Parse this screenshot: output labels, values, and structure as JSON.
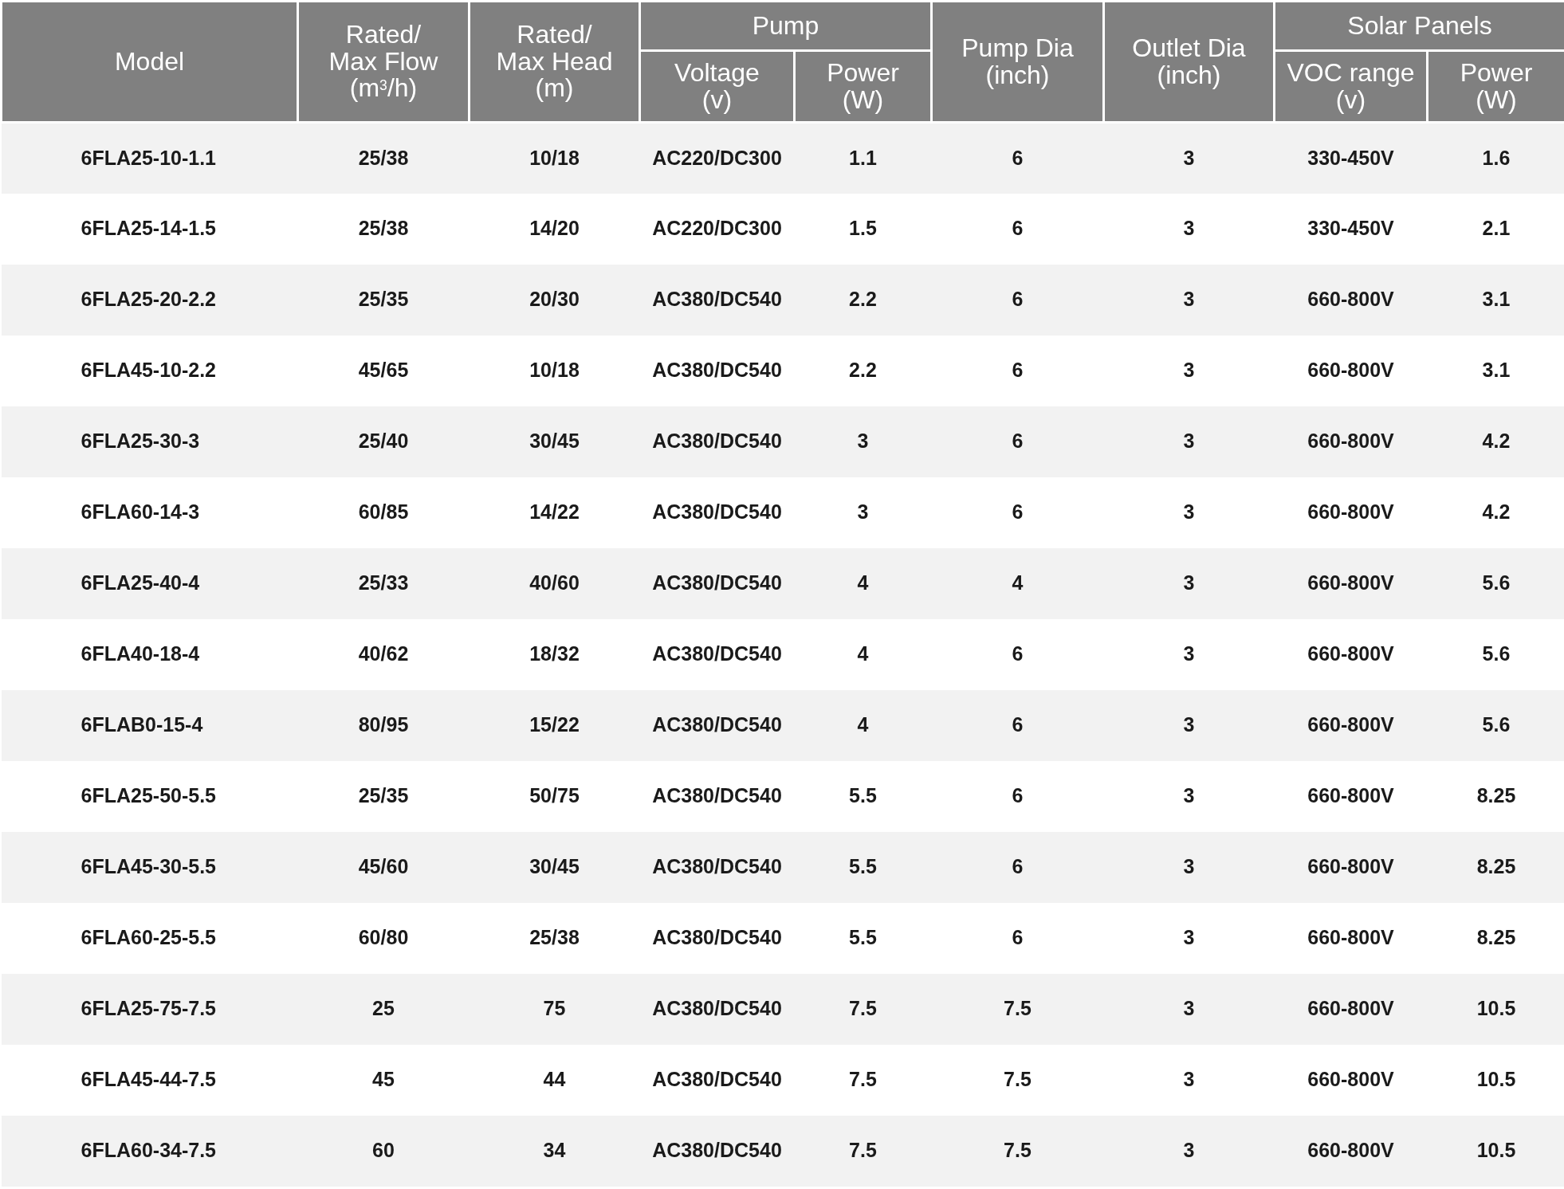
{
  "columns": [
    {
      "label": "Model"
    },
    {
      "label": "Rated/\nMax Flow\n(m$^{3}$/h)"
    },
    {
      "label": "Rated/\nMax Head\n(m)"
    },
    {
      "label": "Pump",
      "children": [
        {
          "label": "Voltage\n(v)"
        },
        {
          "label": "Power\n(W)"
        }
      ]
    },
    {
      "label": "Pump Dia\n(inch)"
    },
    {
      "label": "Outlet Dia\n(inch)"
    },
    {
      "label": "Solar Panels",
      "children": [
        {
          "label": "VOC range\n(v)"
        },
        {
          "label": "Power\n(W)"
        }
      ]
    }
  ],
  "rows": [
    [
      "6FLA25-10-1.1",
      "25/38",
      "10/18",
      "AC220/DC300",
      "1.1",
      "6",
      "3",
      "330-450V",
      "1.6"
    ],
    [
      "6FLA25-14-1.5",
      "25/38",
      "14/20",
      "AC220/DC300",
      "1.5",
      "6",
      "3",
      "330-450V",
      "2.1"
    ],
    [
      "6FLA25-20-2.2",
      "25/35",
      "20/30",
      "AC380/DC540",
      "2.2",
      "6",
      "3",
      "660-800V",
      "3.1"
    ],
    [
      "6FLA45-10-2.2",
      "45/65",
      "10/18",
      "AC380/DC540",
      "2.2",
      "6",
      "3",
      "660-800V",
      "3.1"
    ],
    [
      "6FLA25-30-3",
      "25/40",
      "30/45",
      "AC380/DC540",
      "3",
      "6",
      "3",
      "660-800V",
      "4.2"
    ],
    [
      "6FLA60-14-3",
      "60/85",
      "14/22",
      "AC380/DC540",
      "3",
      "6",
      "3",
      "660-800V",
      "4.2"
    ],
    [
      "6FLA25-40-4",
      "25/33",
      "40/60",
      "AC380/DC540",
      "4",
      "4",
      "3",
      "660-800V",
      "5.6"
    ],
    [
      "6FLA40-18-4",
      "40/62",
      "18/32",
      "AC380/DC540",
      "4",
      "6",
      "3",
      "660-800V",
      "5.6"
    ],
    [
      "6FLAB0-15-4",
      "80/95",
      "15/22",
      "AC380/DC540",
      "4",
      "6",
      "3",
      "660-800V",
      "5.6"
    ],
    [
      "6FLA25-50-5.5",
      "25/35",
      "50/75",
      "AC380/DC540",
      "5.5",
      "6",
      "3",
      "660-800V",
      "8.25"
    ],
    [
      "6FLA45-30-5.5",
      "45/60",
      "30/45",
      "AC380/DC540",
      "5.5",
      "6",
      "3",
      "660-800V",
      "8.25"
    ],
    [
      "6FLA60-25-5.5",
      "60/80",
      "25/38",
      "AC380/DC540",
      "5.5",
      "6",
      "3",
      "660-800V",
      "8.25"
    ],
    [
      "6FLA25-75-7.5",
      "25",
      "75",
      "AC380/DC540",
      "7.5",
      "7.5",
      "3",
      "660-800V",
      "10.5"
    ],
    [
      "6FLA45-44-7.5",
      "45",
      "44",
      "AC380/DC540",
      "7.5",
      "7.5",
      "3",
      "660-800V",
      "10.5"
    ],
    [
      "6FLA60-34-7.5",
      "60",
      "34",
      "AC380/DC540",
      "7.5",
      "7.5",
      "3",
      "660-800V",
      "10.5"
    ]
  ]
}
